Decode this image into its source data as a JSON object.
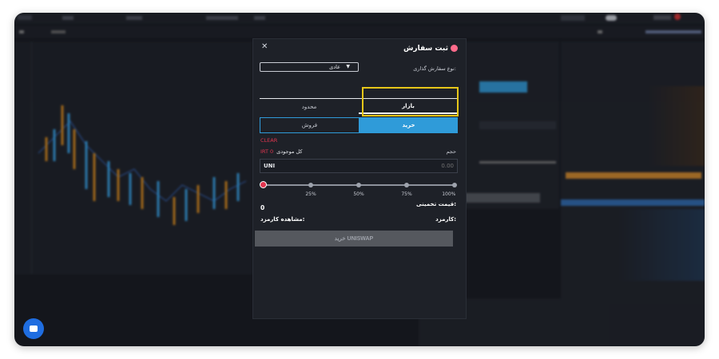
{
  "modal": {
    "title": "ثبت سفارش",
    "order_type_label": "نوع سفارش گذاری:",
    "order_type_value": "عادی",
    "type_tabs": [
      "بازار",
      "محدود"
    ],
    "side_tabs": [
      "خرید",
      "فروش"
    ],
    "clear_label": "CLEAR",
    "volume_label": "حجم",
    "available_label": "کل موجودی",
    "available_value": "IRT 0",
    "amount_unit": "UNI",
    "amount_placeholder": "0.00",
    "slider_marks": [
      "25%",
      "50%",
      "75%",
      "100%"
    ],
    "slider_value": 0,
    "estimated_price_label": "قیمت تخمینی:",
    "estimated_price_value": "0",
    "fee_label": "کارمزد:",
    "fee_link": "مشاهده کارمزد:",
    "submit_label": "خرید UNISWAP"
  },
  "colors": {
    "buy": "#2f9bd9",
    "accent_red": "#e0354f",
    "highlight": "#e6c619"
  }
}
